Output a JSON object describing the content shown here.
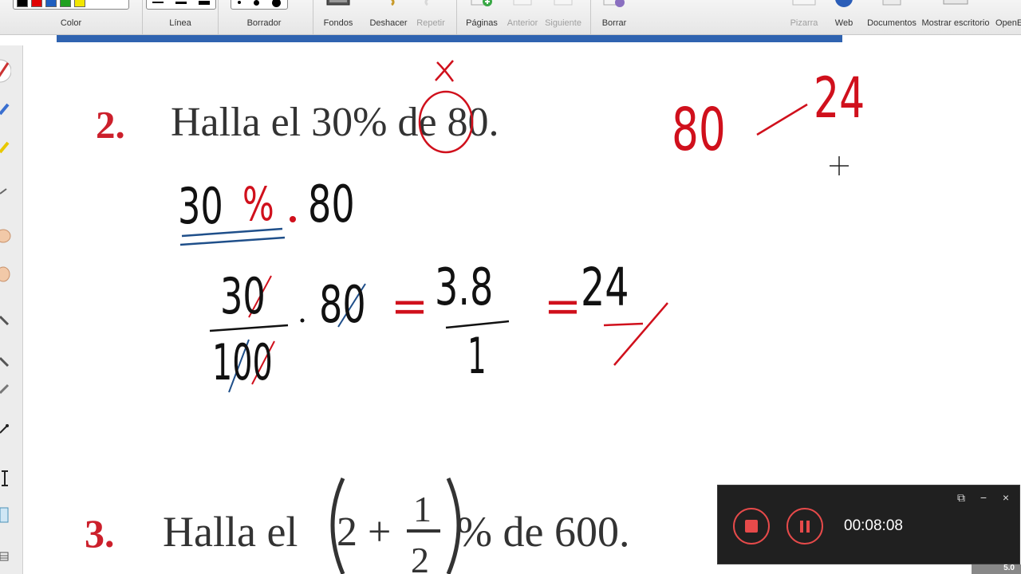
{
  "toolbar": {
    "color_label": "Color",
    "line_label": "Línea",
    "eraser_label": "Borrador",
    "backgrounds_label": "Fondos",
    "undo_label": "Deshacer",
    "redo_label": "Repetir",
    "pages_label": "Páginas",
    "previous_label": "Anterior",
    "next_label": "Siguiente",
    "clear_label": "Borrar",
    "board_label": "Pizarra",
    "web_label": "Web",
    "documents_label": "Documentos",
    "desktop_label": "Mostrar escritorio",
    "open_label": "OpenE",
    "swatch_colors": [
      "#000000",
      "#e00000",
      "#1f5fbf",
      "#1fa01f",
      "#f2e600"
    ]
  },
  "document": {
    "q2_number": "2.",
    "q2_text": "Halla el 30% de 80.",
    "q3_number": "3.",
    "q3_prefix": "Halla el",
    "q3_whole": "2 +",
    "q3_numerator": "1",
    "q3_denominator": "2",
    "q3_suffix": "% de 600."
  },
  "handwriting": {
    "top_x": "x",
    "side_left": "80",
    "side_right": "24",
    "line1_number": "30",
    "line1_percent": "%",
    "line1_times": "80",
    "frac_numerator": "30",
    "frac_denominator": "100",
    "frac_times": "80",
    "equals1": "=",
    "mid_numerator": "3.8",
    "mid_denominator": "1",
    "equals2": "=",
    "result": "24"
  },
  "recorder": {
    "timer": "00:08:08"
  },
  "corner_badge": "5.0",
  "colors": {
    "ink_black": "#111111",
    "ink_red": "#d0101c",
    "ink_blue": "#1f4f8a",
    "accent_blue": "#2f63b0",
    "recorder_red": "#e64a4a"
  }
}
